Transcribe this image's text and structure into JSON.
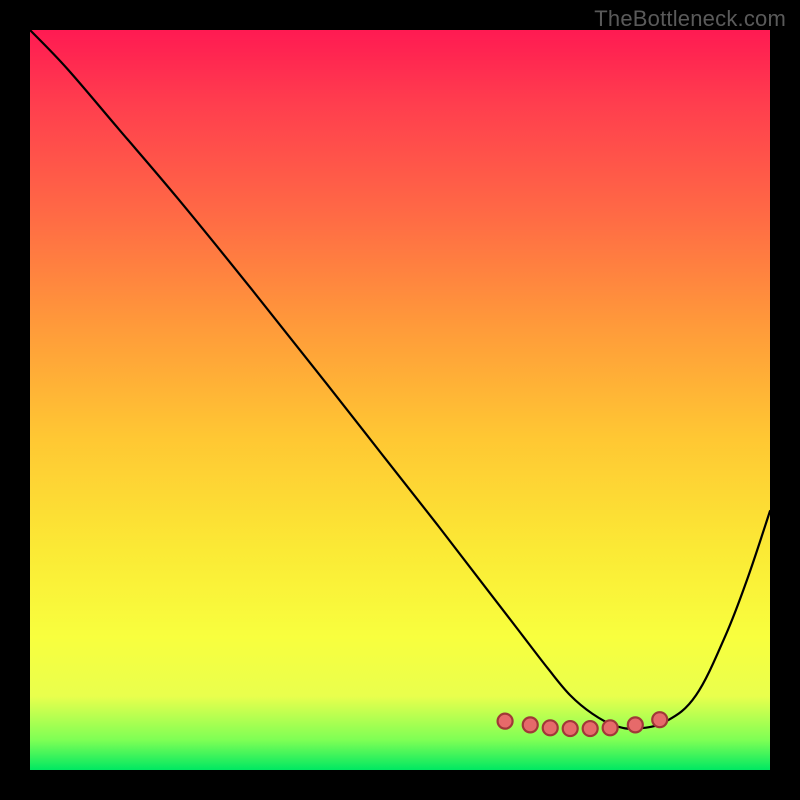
{
  "watermark": "TheBottleneck.com",
  "chart_data": {
    "type": "line",
    "title": "",
    "xlabel": "",
    "ylabel": "",
    "xlim": [
      0,
      100
    ],
    "ylim": [
      0,
      100
    ],
    "grid": false,
    "legend": false,
    "background_gradient": {
      "direction": "vertical",
      "stops": [
        {
          "pct": 0,
          "color": "#ff1a52"
        },
        {
          "pct": 25,
          "color": "#ff6a45"
        },
        {
          "pct": 55,
          "color": "#ffc733"
        },
        {
          "pct": 82,
          "color": "#f8ff3e"
        },
        {
          "pct": 96,
          "color": "#7dff55"
        },
        {
          "pct": 100,
          "color": "#00e862"
        }
      ]
    },
    "series": [
      {
        "name": "bottleneck-curve",
        "x": [
          0.0,
          5.0,
          12.0,
          20.0,
          30.0,
          40.0,
          48.0,
          55.0,
          62.0,
          66.0,
          70.0,
          73.0,
          76.0,
          79.0,
          82.0,
          86.0,
          90.0,
          94.0,
          97.0,
          100.0
        ],
        "y": [
          100.0,
          94.8,
          86.6,
          77.2,
          64.9,
          52.3,
          42.1,
          33.2,
          24.1,
          18.9,
          13.7,
          10.1,
          7.6,
          6.0,
          5.6,
          6.6,
          10.1,
          18.2,
          26.0,
          35.0
        ]
      }
    ],
    "markers": {
      "name": "optimal-range",
      "x": [
        64.2,
        67.6,
        70.3,
        73.0,
        75.7,
        78.4,
        81.8,
        85.1
      ],
      "y": [
        6.6,
        6.1,
        5.7,
        5.6,
        5.6,
        5.7,
        6.1,
        6.8
      ]
    }
  }
}
